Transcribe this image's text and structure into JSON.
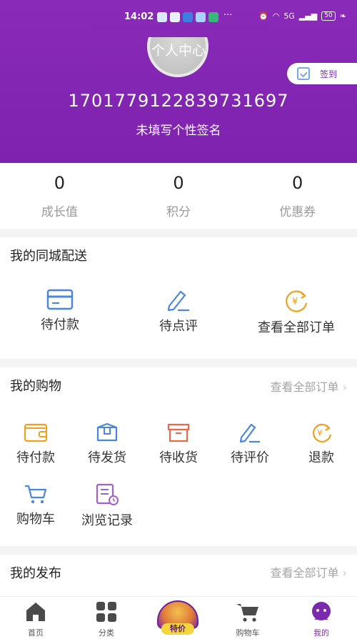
{
  "status_bar": {
    "time": "14:02",
    "more": "···",
    "signal": "5G",
    "battery": "50"
  },
  "header": {
    "title": "个人中心",
    "user_id": "17017791228397316 97",
    "signature": "未填写个性签名",
    "signin_label": "签到"
  },
  "stats": [
    {
      "value": "0",
      "label": "成长值"
    },
    {
      "value": "0",
      "label": "积分"
    },
    {
      "value": "0",
      "label": "优惠券"
    }
  ],
  "delivery": {
    "title": "我的同城配送",
    "items": [
      {
        "label": "待付款",
        "icon": "card-icon"
      },
      {
        "label": "待点评",
        "icon": "pen-icon"
      },
      {
        "label": "查看全部订单",
        "icon": "refund-icon"
      }
    ]
  },
  "shopping": {
    "title": "我的购物",
    "more": "查看全部订单",
    "items": [
      {
        "label": "待付款",
        "icon": "wallet-icon"
      },
      {
        "label": "待发货",
        "icon": "box-icon"
      },
      {
        "label": "待收货",
        "icon": "package-icon"
      },
      {
        "label": "待评价",
        "icon": "pen-icon"
      },
      {
        "label": "退款",
        "icon": "refund-icon"
      },
      {
        "label": "购物车",
        "icon": "cart-icon"
      },
      {
        "label": "浏览记录",
        "icon": "history-icon"
      }
    ]
  },
  "publish": {
    "title": "我的发布",
    "more": "查看全部订单"
  },
  "tabbar": {
    "items": [
      {
        "label": "首页",
        "icon": "home-icon"
      },
      {
        "label": "分类",
        "icon": "category-icon"
      },
      {
        "label": "特价",
        "icon": "special-offer-icon"
      },
      {
        "label": "购物车",
        "icon": "cart-icon"
      },
      {
        "label": "我的",
        "icon": "profile-icon"
      }
    ],
    "active": "我的"
  },
  "colors": {
    "brand": "#7e22b0",
    "icon_blue": "#4a86e0",
    "icon_orange": "#f0a020"
  }
}
